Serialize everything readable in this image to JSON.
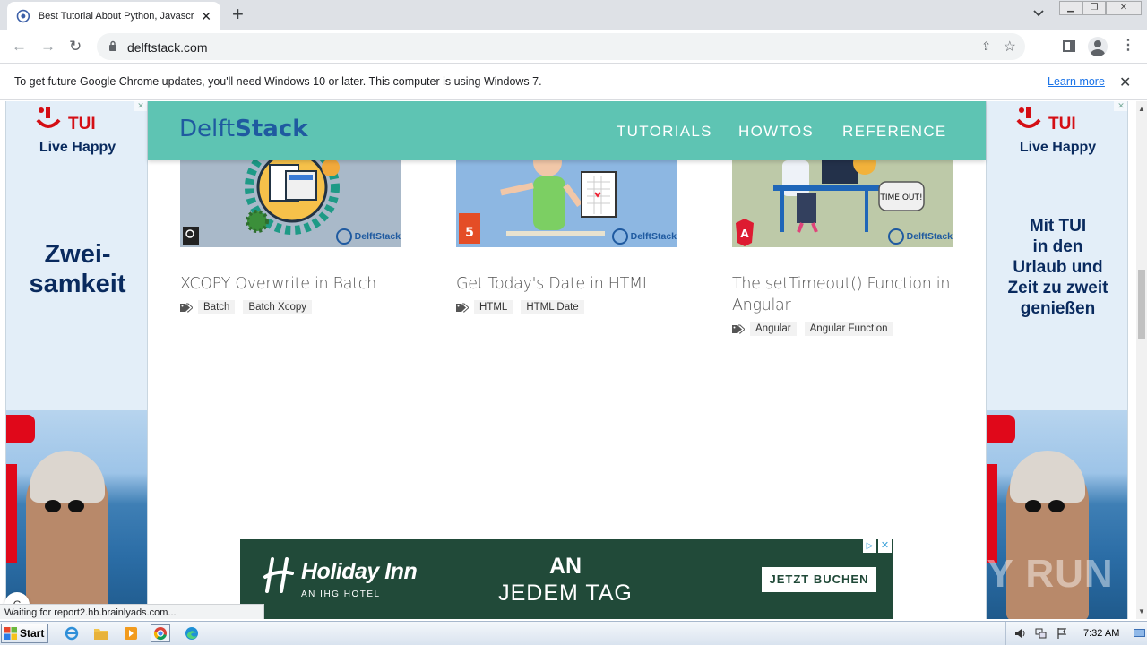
{
  "browser": {
    "tab_title": "Best Tutorial About Python, Javascript",
    "tab_close": "✕",
    "new_tab": "+",
    "tab_dropdown": "⌄",
    "url": "delftstack.com",
    "back": "←",
    "forward": "→",
    "reload": "↻",
    "share": "⇪",
    "bookmark": "☆",
    "menu": "⋮",
    "window": {
      "minimize": "▁",
      "restore": "❐",
      "close": "✕"
    }
  },
  "infobar": {
    "message": "To get future Google Chrome updates, you'll need Windows 10 or later. This computer is using Windows 7.",
    "learn_more": "Learn more",
    "close": "✕"
  },
  "site": {
    "logo_light": "Delft",
    "logo_bold": "Stack",
    "nav": [
      "TUTORIALS",
      "HOWTOS",
      "REFERENCE"
    ]
  },
  "cards": [
    {
      "title": "XCOPY Overwrite in Batch",
      "tags": [
        "Batch",
        "Batch Xcopy"
      ],
      "badge": "DelftStack",
      "bg": "#a9b9c9",
      "accent": "#f6c14a"
    },
    {
      "title": "Get Today's Date in HTML",
      "tags": [
        "HTML",
        "HTML Date"
      ],
      "badge": "DelftStack",
      "bg": "#8db7e2",
      "accent": "#7ccf63"
    },
    {
      "title": "The setTimeout() Function in Angular",
      "tags": [
        "Angular",
        "Angular Function"
      ],
      "badge": "DelftStack",
      "bg": "#bdc9a8",
      "accent": "#dd1b31",
      "bubble": "TIME OUT!"
    }
  ],
  "ads": {
    "left": {
      "brand": "TUI",
      "slogan": "Live Happy",
      "headline": [
        "Zwei-",
        "samkeit"
      ],
      "close": "✕"
    },
    "right": {
      "brand": "TUI",
      "slogan": "Live Happy",
      "headline": [
        "Mit TUI",
        "in den",
        "Urlaub und",
        "Zeit zu zweit",
        "genießen"
      ],
      "close": "✕"
    },
    "banner": {
      "brand": "Holiday Inn",
      "sub": "AN IHG HOTEL",
      "line1": "AN",
      "line2": "JEDEM TAG",
      "cta": "JETZT BUCHEN",
      "adchoice": "▷",
      "close": "✕"
    }
  },
  "watermark": "ANY RUN",
  "status_text": "Waiting for report2.hb.brainlyads.com...",
  "spinner": "C",
  "scrollbar": {
    "up": "▲",
    "down": "▼"
  },
  "taskbar": {
    "start": "Start",
    "clock": "7:32 AM"
  },
  "colors": {
    "site_nav": "#5ec4b3",
    "logo": "#1f5aa0",
    "banner_bg": "#214a39",
    "tui_red": "#d40e14",
    "tui_navy": "#092a5e"
  }
}
